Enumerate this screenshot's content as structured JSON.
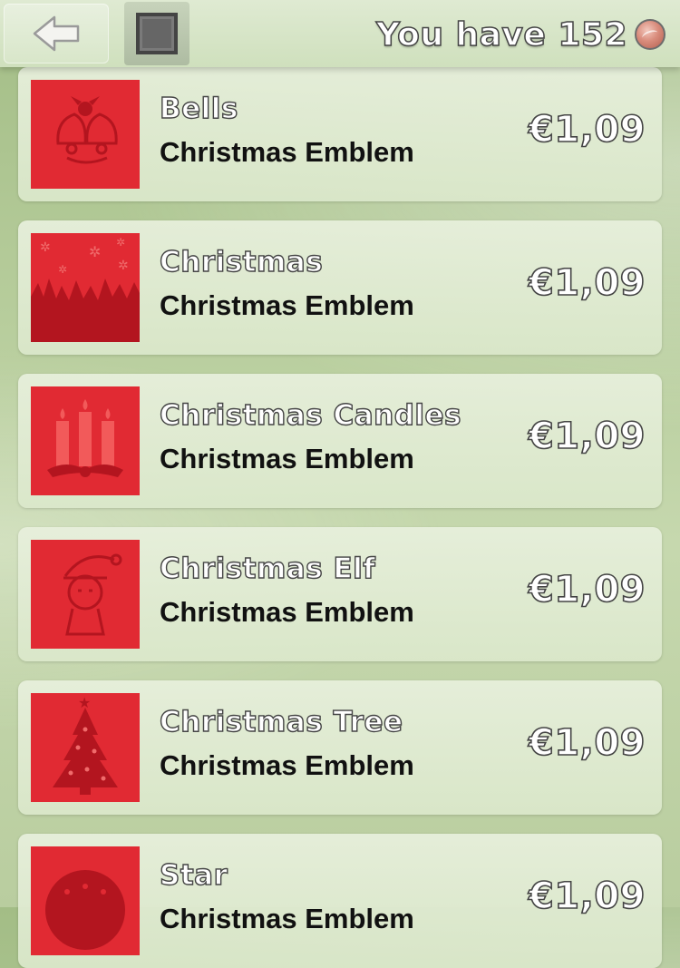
{
  "header": {
    "balance_text": "You have 152",
    "currency_icon": "coin-icon"
  },
  "items": [
    {
      "name": "Bells",
      "category": "Christmas Emblem",
      "price": "€1,09",
      "icon": "bells-icon"
    },
    {
      "name": "Christmas",
      "category": "Christmas Emblem",
      "price": "€1,09",
      "icon": "christmas-forest-icon"
    },
    {
      "name": "Christmas Candles",
      "category": "Christmas Emblem",
      "price": "€1,09",
      "icon": "candles-icon"
    },
    {
      "name": "Christmas Elf",
      "category": "Christmas Emblem",
      "price": "€1,09",
      "icon": "elf-icon"
    },
    {
      "name": "Christmas Tree",
      "category": "Christmas Emblem",
      "price": "€1,09",
      "icon": "tree-icon"
    },
    {
      "name": "Star",
      "category": "Christmas Emblem",
      "price": "€1,09",
      "icon": "star-icon"
    }
  ],
  "colors": {
    "thumb_red": "#e12a33",
    "thumb_dark": "#b3151f"
  }
}
